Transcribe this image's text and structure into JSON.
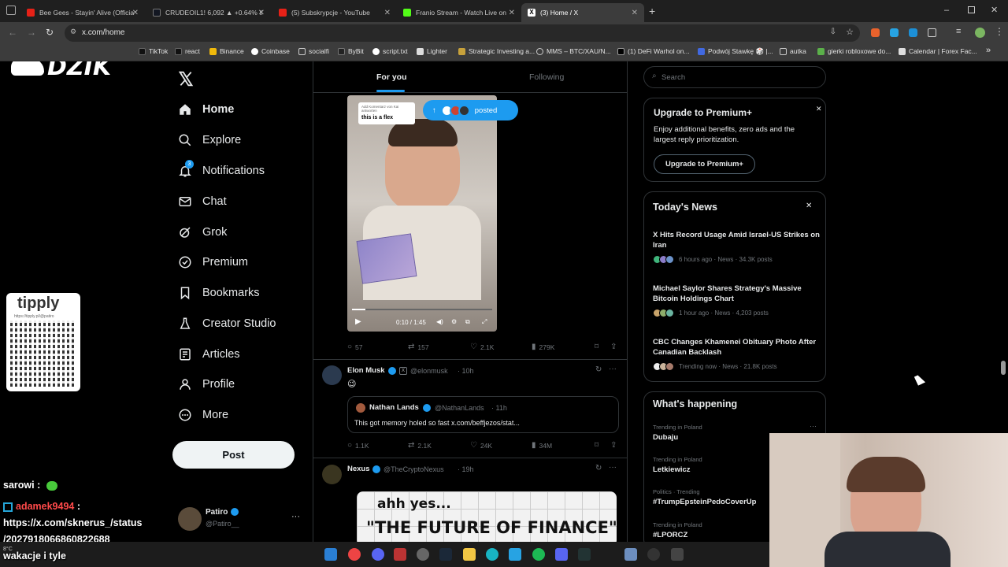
{
  "browser": {
    "tabs": [
      {
        "title": "Bee Gees - Stayin' Alive (Officia",
        "color": "#e62117"
      },
      {
        "title": "CRUDEOIL1! 6,092 ▲ +0.64% Il",
        "color": "#131722"
      },
      {
        "title": "(5) Subskrypcje - YouTube",
        "color": "#e62117"
      },
      {
        "title": "Franio Stream - Watch Live on",
        "color": "#53fc18"
      },
      {
        "title": "(3) Home / X",
        "color": "#ffffff"
      }
    ],
    "new_tab": "+",
    "url": "x.com/home",
    "bookmarks": [
      "TikTok",
      "react",
      "Binance",
      "Coinbase",
      "socialfi",
      "ByBit",
      "script.txt",
      "Lighter",
      "Strategic Investing a...",
      "MMS – BTC/XAU/N...",
      "(1) DeFi Warhol on...",
      "Podwój Stawkę 🎲 |...",
      "autka",
      "gierki robloxowe do...",
      "Calendar | Forex Fac..."
    ],
    "more_bookmarks": "»"
  },
  "overlay": {
    "logo_text": "DZIK",
    "tipply_title": "tipply",
    "tipply_url": "https://tipply.pl/@patiro",
    "chat": [
      {
        "user": "sarowi :",
        "user_color": "#ffffff",
        "msg": ""
      },
      {
        "user": "adamek9494",
        "user_color": "#ff4040",
        "msg": ":"
      },
      {
        "user": "",
        "user_color": "#ffffff",
        "msg": "https://x.com/sknerus_/status"
      },
      {
        "user": "",
        "user_color": "#ffffff",
        "msg": "/2027918066860822688"
      },
      {
        "user": "",
        "user_color": "#ffffff",
        "msg": "wakacje i tyle"
      }
    ]
  },
  "nav": {
    "logo": "X",
    "items": [
      {
        "label": "Home",
        "icon": "home-icon"
      },
      {
        "label": "Explore",
        "icon": "search-icon"
      },
      {
        "label": "Notifications",
        "icon": "bell-icon",
        "badge": "3"
      },
      {
        "label": "Chat",
        "icon": "mail-icon"
      },
      {
        "label": "Grok",
        "icon": "grok-icon"
      },
      {
        "label": "Premium",
        "icon": "verified-icon"
      },
      {
        "label": "Bookmarks",
        "icon": "bookmark-icon"
      },
      {
        "label": "Creator Studio",
        "icon": "flask-icon"
      },
      {
        "label": "Articles",
        "icon": "article-icon"
      },
      {
        "label": "Profile",
        "icon": "user-icon"
      },
      {
        "label": "More",
        "icon": "more-icon"
      }
    ],
    "post_label": "Post",
    "account": {
      "name": "Patiro",
      "handle": "@Patiro__",
      "more": "···"
    }
  },
  "feed": {
    "tabs": [
      "For you",
      "Following"
    ],
    "active_tab": 0,
    "posted_pill": "posted",
    "video": {
      "caption_top": "Add Komentarz von Kai antworten",
      "caption": "this is a flex",
      "time": "0:10 / 1:45",
      "progress": 0.095
    },
    "post1_actions": {
      "replies": "57",
      "reposts": "157",
      "likes": "2.1K",
      "views": "279K"
    },
    "post2": {
      "name": "Elon Musk",
      "handle": "@elonmusk",
      "time": "· 10h",
      "text": "😉",
      "quote": {
        "name": "Nathan Lands",
        "handle": "@NathanLands",
        "time": "· 11h",
        "text": "This got memory holed so fast x.com/beffjezos/stat..."
      },
      "actions": {
        "replies": "1.1K",
        "reposts": "2.1K",
        "likes": "24K",
        "views": "34M"
      }
    },
    "post3": {
      "name": "Nexus",
      "handle": "@TheCryptoNexus",
      "time": "· 19h",
      "image_line1": "ahh yes...",
      "image_line2": "\"THE FUTURE OF FINANCE\""
    }
  },
  "right": {
    "search_placeholder": "Search",
    "premium": {
      "title": "Upgrade to Premium+",
      "body": "Enjoy additional benefits, zero ads and the largest reply prioritization.",
      "button": "Upgrade to Premium+",
      "close": "✕"
    },
    "news": {
      "title": "Today's News",
      "close": "✕",
      "items": [
        {
          "title": "X Hits Record Usage Amid Israel-US Strikes on Iran",
          "meta": "6 hours ago · News · 34.3K posts"
        },
        {
          "title": "Michael Saylor Shares Strategy's Massive Bitcoin Holdings Chart",
          "meta": "1 hour ago · News · 4,203 posts"
        },
        {
          "title": "CBC Changes Khamenei Obituary Photo After Canadian Backlash",
          "meta": "Trending now · News · 21.8K posts"
        }
      ]
    },
    "happening": {
      "title": "What's happening",
      "more": "···",
      "items": [
        {
          "context": "Trending in Poland",
          "name": "Dubaju"
        },
        {
          "context": "Trending in Poland",
          "name": "Letkiewicz"
        },
        {
          "context": "Politics · Trending",
          "name": "#TrumpEpsteinPedoCoverUp"
        },
        {
          "context": "Trending in Poland",
          "name": "#LPORCZ"
        }
      ]
    }
  },
  "taskbar": {
    "weather": "8°C"
  }
}
